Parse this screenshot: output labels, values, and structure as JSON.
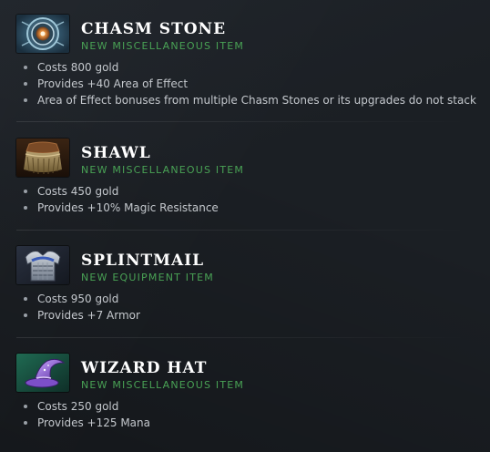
{
  "items": [
    {
      "name": "CHASM STONE",
      "category": "NEW MISCELLANEOUS ITEM",
      "icon": "chasm-stone-icon",
      "details": [
        "Costs 800 gold",
        "Provides +40 Area of Effect",
        "Area of Effect bonuses from multiple Chasm Stones or its upgrades do not stack"
      ]
    },
    {
      "name": "SHAWL",
      "category": "NEW MISCELLANEOUS ITEM",
      "icon": "shawl-icon",
      "details": [
        "Costs 450 gold",
        "Provides +10% Magic Resistance"
      ]
    },
    {
      "name": "SPLINTMAIL",
      "category": "NEW EQUIPMENT ITEM",
      "icon": "splintmail-icon",
      "details": [
        "Costs 950 gold",
        "Provides +7 Armor"
      ]
    },
    {
      "name": "WIZARD HAT",
      "category": "NEW MISCELLANEOUS ITEM",
      "icon": "wizard-hat-icon",
      "details": [
        "Costs 250 gold",
        "Provides +125 Mana"
      ]
    }
  ],
  "colors": {
    "background": "#1b1f24",
    "title": "#ffffff",
    "category": "#49a255",
    "text": "#c4c8cd"
  }
}
